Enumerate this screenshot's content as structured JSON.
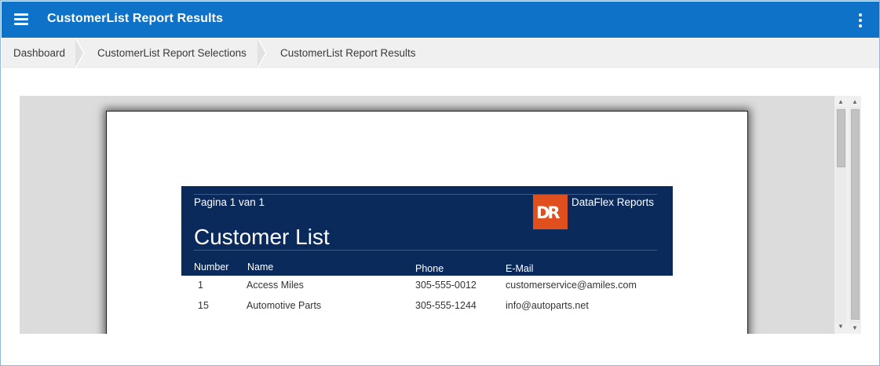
{
  "app": {
    "title": "CustomerList Report Results",
    "menu_icon": "hamburger-menu-icon",
    "more_icon": "vertical-dots-icon",
    "accent_color": "#0f72c9"
  },
  "breadcrumb": {
    "items": [
      {
        "label": "Dashboard"
      },
      {
        "label": "CustomerList Report Selections"
      },
      {
        "label": "CustomerList Report Results"
      }
    ]
  },
  "report": {
    "page_indicator": "Pagina 1 van 1",
    "logo_text": "DR",
    "brand": "DataFlex Reports",
    "title": "Customer List",
    "banner_color": "#0a2a5c",
    "logo_color": "#e0501e",
    "columns": [
      "Number",
      "Name",
      "Phone",
      "E-Mail"
    ],
    "rows": [
      {
        "number": "1",
        "name": "Access Miles",
        "phone": "305-555-0012",
        "email": "customerservice@amiles.com"
      },
      {
        "number": "15",
        "name": "Automotive Parts",
        "phone": "305-555-1244",
        "email": "info@autoparts.net"
      }
    ]
  },
  "scrollbar": {
    "up_icon": "scroll-up-arrow-icon",
    "down_icon": "scroll-down-arrow-icon"
  }
}
